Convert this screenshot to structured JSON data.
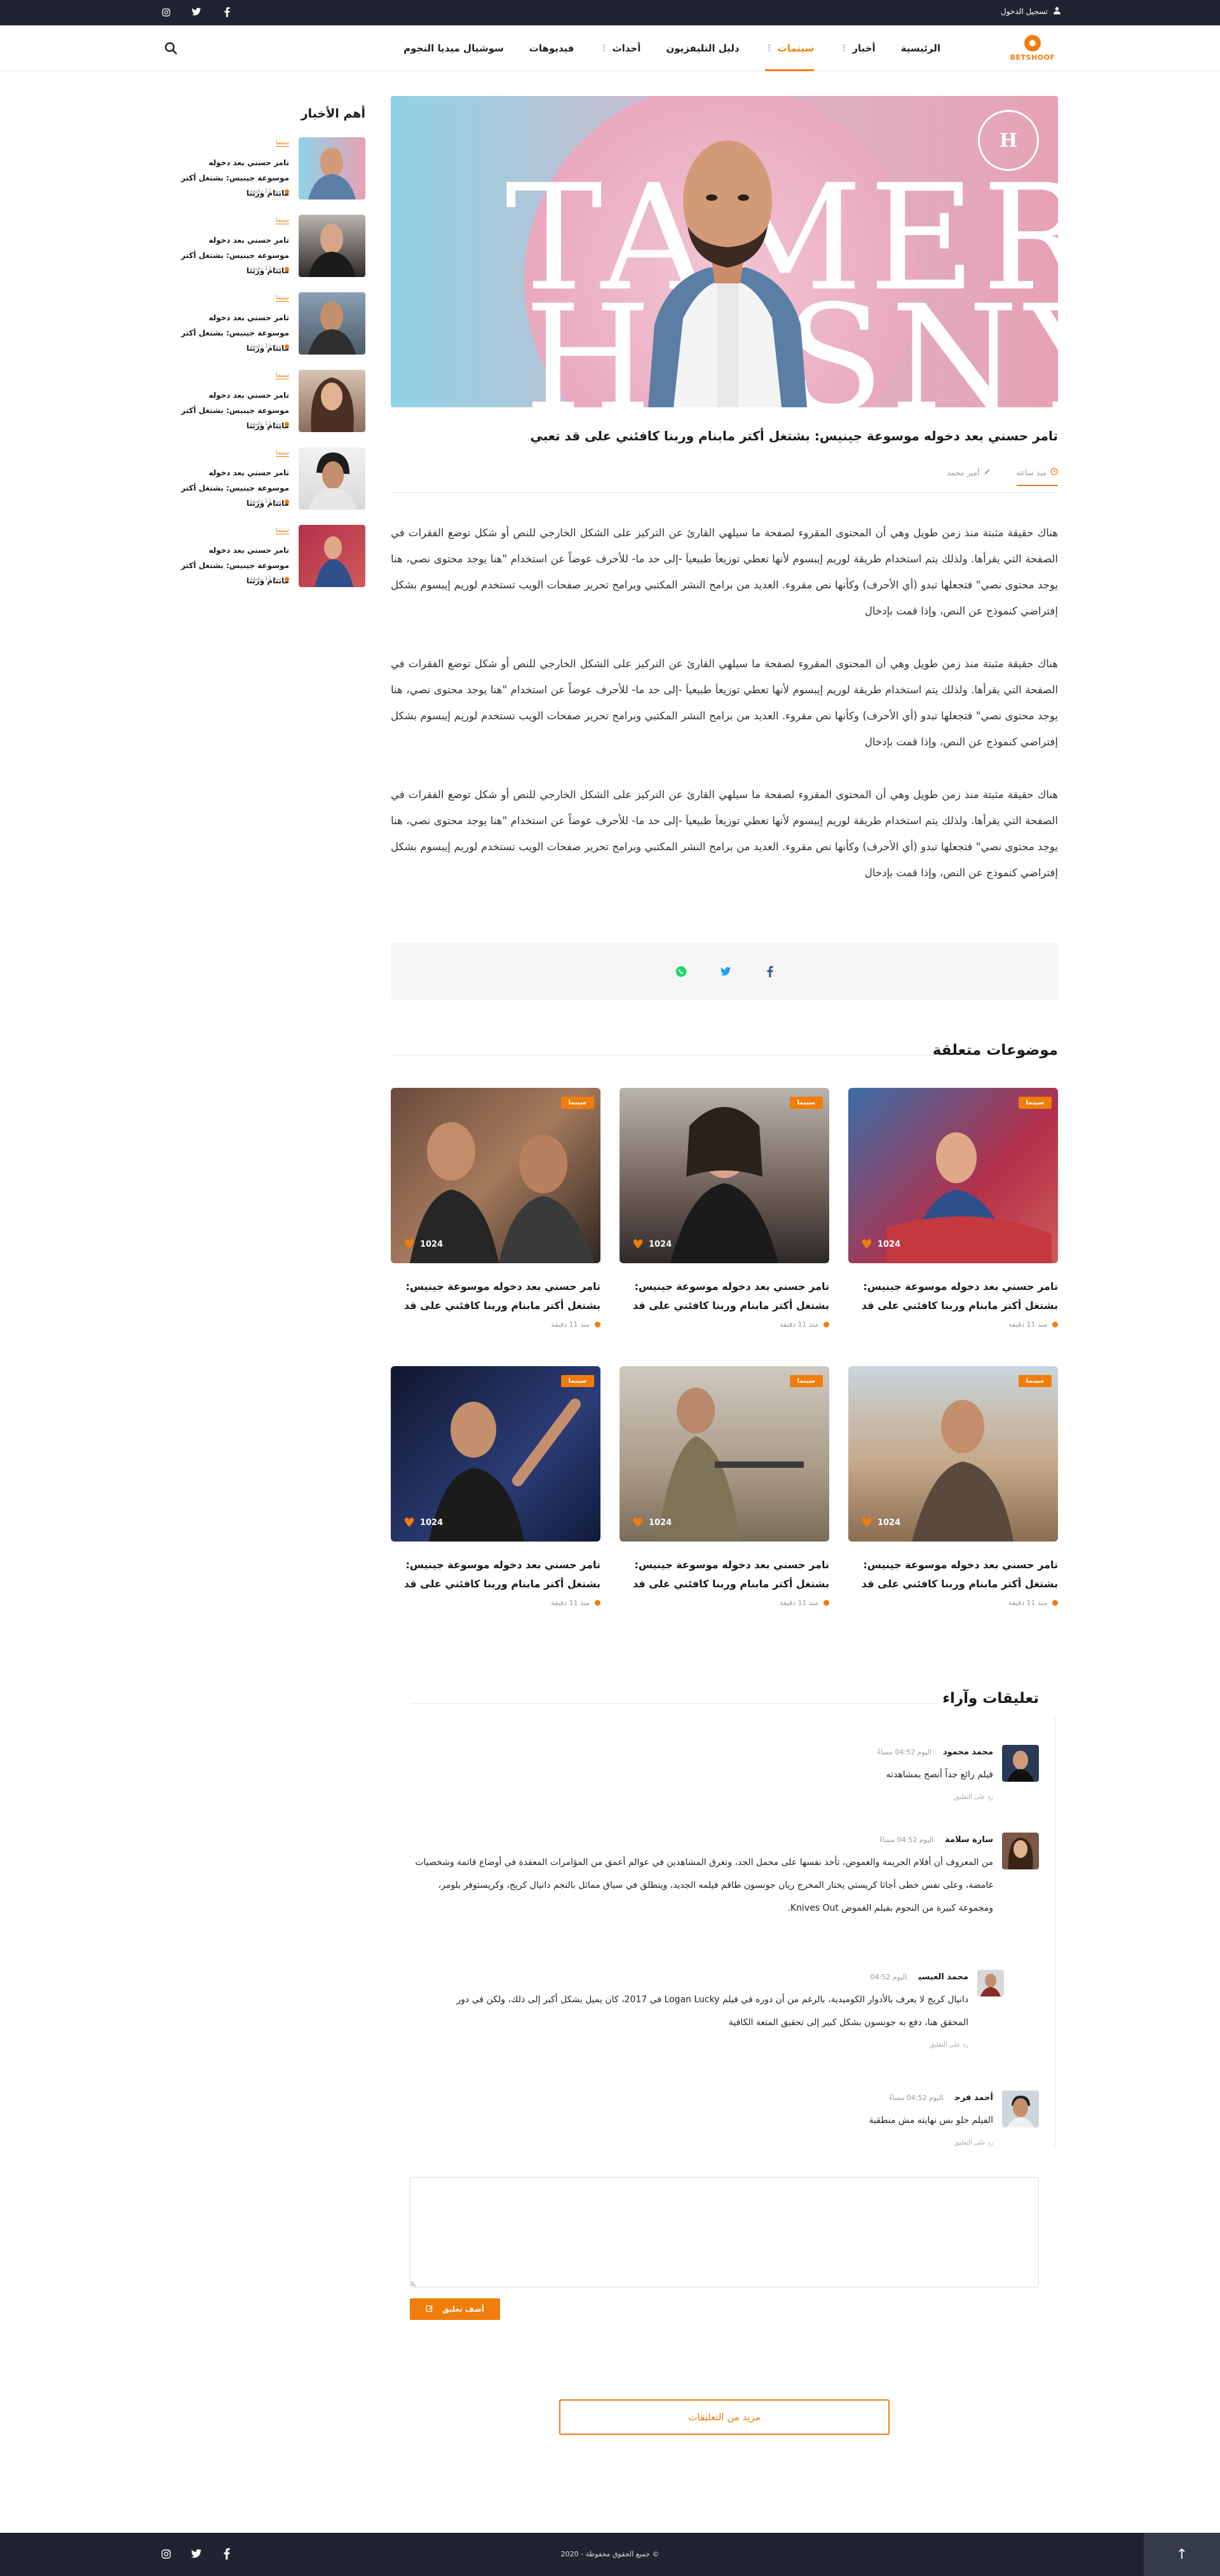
{
  "topbar": {
    "login_label": "تسجيل الدخول",
    "social": [
      "instagram-icon",
      "twitter-icon",
      "facebook-icon"
    ]
  },
  "header": {
    "logo_text": "BETSHOOF",
    "nav": [
      {
        "label": "الرئيسية",
        "active": false,
        "dropdown": false
      },
      {
        "label": "أخبار",
        "active": false,
        "dropdown": true
      },
      {
        "label": "سينمات",
        "active": true,
        "dropdown": true
      },
      {
        "label": "دليل التليفزيون",
        "active": false,
        "dropdown": false
      },
      {
        "label": "أحداث",
        "active": false,
        "dropdown": true
      },
      {
        "label": "فيديوهات",
        "active": false,
        "dropdown": false
      },
      {
        "label": "سوشيال ميديا النجوم",
        "active": false,
        "dropdown": false
      }
    ]
  },
  "article": {
    "hero_text_top": "TAMER",
    "hero_text_bottom": "HOSNY",
    "title": "تامر حسني بعد دخوله موسوعة جينيس: بشتغل أكتر مابنام وربنا كافئني على قد تعبي",
    "time": "منذ ساعة",
    "author": "أمير محمد",
    "paragraphs": [
      "هناك حقيقة مثبتة منذ زمن طويل وهي أن المحتوى المقروء لصفحة ما سيلهي القارئ عن التركيز على الشكل الخارجي للنص أو شكل توضع الفقرات في الصفحة التي يقرأها. ولذلك يتم استخدام طريقة لوريم إيبسوم لأنها تعطي توزيعاَ طبيعياَ -إلى حد ما- للأحرف عوضاً عن استخدام \"هنا يوجد محتوى نصي، هنا يوجد محتوى نصي\" فتجعلها تبدو (أي الأحرف) وكأنها نص مقروء. العديد من برامح النشر المكتبي وبرامح تحرير صفحات الويب تستخدم لوريم إيبسوم بشكل إفتراضي كنموذج عن النص، وإذا قمت بإدخال",
      "هناك حقيقة مثبتة منذ زمن طويل وهي أن المحتوى المقروء لصفحة ما سيلهي القارئ عن التركيز على الشكل الخارجي للنص أو شكل توضع الفقرات في الصفحة التي يقرأها. ولذلك يتم استخدام طريقة لوريم إيبسوم لأنها تعطي توزيعاَ طبيعياَ -إلى حد ما- للأحرف عوضاً عن استخدام \"هنا يوجد محتوى نصي، هنا يوجد محتوى نصي\" فتجعلها تبدو (أي الأحرف) وكأنها نص مقروء. العديد من برامح النشر المكتبي وبرامح تحرير صفحات الويب تستخدم لوريم إيبسوم بشكل إفتراضي كنموذج عن النص، وإذا قمت بإدخال",
      "هناك حقيقة مثبتة منذ زمن طويل وهي أن المحتوى المقروء لصفحة ما سيلهي القارئ عن التركيز على الشكل الخارجي للنص أو شكل توضع الفقرات في الصفحة التي يقرأها. ولذلك يتم استخدام طريقة لوريم إيبسوم لأنها تعطي توزيعاَ طبيعياَ -إلى حد ما- للأحرف عوضاً عن استخدام \"هنا يوجد محتوى نصي، هنا يوجد محتوى نصي\" فتجعلها تبدو (أي الأحرف) وكأنها نص مقروء. العديد من برامح النشر المكتبي وبرامح تحرير صفحات الويب تستخدم لوريم إيبسوم بشكل إفتراضي كنموذج عن النص، وإذا قمت بإدخال"
    ],
    "share": [
      "facebook-icon",
      "twitter-icon",
      "whatsapp-icon"
    ]
  },
  "related": {
    "title": "موضوعات متعلقة",
    "cards": [
      {
        "tag": "سينما",
        "likes": "1024",
        "title": "تامر حسني بعد دخوله موسوعة جينيس: بشتغل أكتر مابنام وربنا كافئني على قد",
        "time": "منذ 11 دقيقة"
      },
      {
        "tag": "سينما",
        "likes": "1024",
        "title": "تامر حسني بعد دخوله موسوعة جينيس: بشتغل أكتر مابنام وربنا كافئني على قد",
        "time": "منذ 11 دقيقة"
      },
      {
        "tag": "سينما",
        "likes": "1024",
        "title": "تامر حسني بعد دخوله موسوعة جينيس: بشتغل أكتر مابنام وربنا كافئني على قد",
        "time": "منذ 11 دقيقة"
      },
      {
        "tag": "سينما",
        "likes": "1024",
        "title": "تامر حسني بعد دخوله موسوعة جينيس: بشتغل أكتر مابنام وربنا كافئني على قد",
        "time": "منذ 11 دقيقة"
      },
      {
        "tag": "سينما",
        "likes": "1024",
        "title": "تامر حسني بعد دخوله موسوعة جينيس: بشتغل أكتر مابنام وربنا كافئني على قد",
        "time": "منذ 11 دقيقة"
      },
      {
        "tag": "سينما",
        "likes": "1024",
        "title": "تامر حسني بعد دخوله موسوعة جينيس: بشتغل أكتر مابنام وربنا كافئني على قد",
        "time": "منذ 11 دقيقة"
      }
    ]
  },
  "sidebar": {
    "title": "أهم الأخبار",
    "items": [
      {
        "tag": "سينما",
        "title": "تامر حسني بعد دخوله موسوعة جينيس: بشتغل أكتر مابنام وربنا",
        "time": "منذ 11 دقيقة"
      },
      {
        "tag": "سينما",
        "title": "تامر حسني بعد دخوله موسوعة جينيس: بشتغل أكتر مابنام وربنا",
        "time": "منذ 11 دقيقة"
      },
      {
        "tag": "سينما",
        "title": "تامر حسني بعد دخوله موسوعة جينيس: بشتغل أكتر مابنام وربنا",
        "time": "منذ 11 دقيقة"
      },
      {
        "tag": "سينما",
        "title": "تامر حسني بعد دخوله موسوعة جينيس: بشتغل أكتر مابنام وربنا",
        "time": "منذ 11 دقيقة"
      },
      {
        "tag": "سينما",
        "title": "تامر حسني بعد دخوله موسوعة جينيس: بشتغل أكتر مابنام وربنا",
        "time": "منذ 11 دقيقة"
      },
      {
        "tag": "سينما",
        "title": "تامر حسني بعد دخوله موسوعة جينيس: بشتغل أكتر مابنام وربنا",
        "time": "منذ 11 دقيقة"
      }
    ]
  },
  "comments": {
    "title": "تعليقات وآراء",
    "list": [
      {
        "name": "محمد محمود",
        "when": "اليوم 04:52 مساءً",
        "body": "فيلم رائع جداً أنصح بمشاهدته",
        "reply": "رد على التعليق"
      },
      {
        "name": "سارة سلامة",
        "when": "اليوم 04:52 مساءً",
        "body": "من المعروف أن أفلام الجريمة والغموض، تأخذ نفسها على محمل الجد، وتغرق المشاهدين في عوالم أعمق من المؤامرات المعقدة في أوضاع قاتمة وشخصيات غامضة، وعلى نفس خطى أجاثا كريستي يختار المخرج ريان جونسون طاقم فيلمه الجديد، وينطلق في سياق مماثل بالنجم دانيال كريج، وكريستوفر بلومر، ومجموعة كبيرة من النجوم بفيلم الغموض Knives Out.",
        "reply": ""
      },
      {
        "name": "محمد العيسي",
        "when": "اليوم 04:52",
        "body": "دانيال كريج لا يعرف بالأدوار الكوميدية، بالرغم من أن دوره في فيلم Logan Lucky في 2017، كان يميل بشكل أكبر إلى ذلك، ولكن في دور المحقق هنا، دفع به جونسون بشكل كبير إلى تحقيق المتعة الكافية",
        "reply": "رد على التعليق"
      },
      {
        "name": "أحمد فرج",
        "when": "اليوم 04:52 مساءً",
        "body": "الفيلم حلو بس نهايته مش منطقية",
        "reply": "رد على التعليق"
      }
    ],
    "add_label": "أضف تعليق",
    "more_label": "مزيد من التعليقات"
  },
  "footer": {
    "copyright": "© جميع الحقوق محفوظة - 2020",
    "social": [
      "instagram-icon",
      "twitter-icon",
      "facebook-icon"
    ]
  },
  "colors": {
    "accent": "#f07d0b",
    "dark": "#1f2430"
  }
}
